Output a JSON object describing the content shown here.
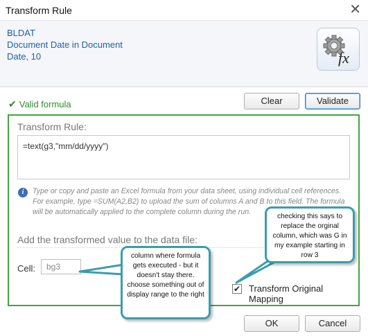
{
  "window": {
    "title": "Transform Rule",
    "close_glyph": "✕"
  },
  "header": {
    "field_code": "BLDAT",
    "field_description": "Document Date in Document",
    "field_type": "Date, 10",
    "icon": "gear-fx-icon",
    "icon_text": "fx"
  },
  "status": {
    "icon": "check-icon",
    "glyph": "✔",
    "text": "Valid formula",
    "color": "#2e8b2e"
  },
  "toolbar": {
    "clear_label": "Clear",
    "validate_label": "Validate"
  },
  "panel": {
    "title": "Transform Rule:",
    "formula_value": "=text(g3,\"mm/dd/yyyy\")",
    "info_icon_text": "i",
    "info_text": "Type or copy and paste an Excel formula from your data sheet, using individual cell references. For example, type =SUM(A2,B2) to upload the sum of columns A and B to this field. The formula will be automatically applied to the complete column during the run.",
    "add_label": "Add the transformed value to the data file:",
    "cell_label": "Cell:",
    "cell_value": "bg3",
    "transform_original_label": "Transform Original Mapping",
    "transform_original_checked": true,
    "check_glyph": "✔",
    "border_color": "#43a43d"
  },
  "footer": {
    "ok_label": "OK",
    "cancel_label": "Cancel"
  },
  "annotations": {
    "cell_note": "column where formula gets executed - but it doesn't stay there. choose something out of display range to the right",
    "checkbox_note": "checking this says to replace the orginal column, which was G in my example starting in row 3",
    "color": "#3a9dae"
  }
}
